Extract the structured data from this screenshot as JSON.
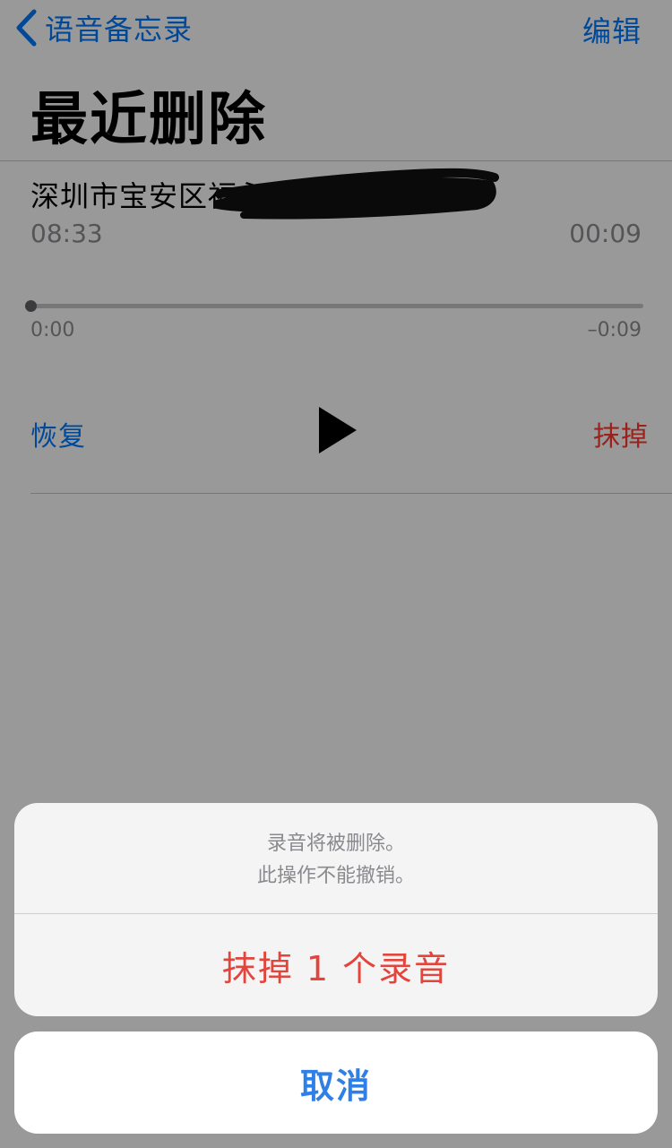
{
  "nav": {
    "back_label": "语音备忘录",
    "edit_label": "编辑"
  },
  "page": {
    "title": "最近删除"
  },
  "recording": {
    "title": "深圳市宝安区福永人民医院急诊",
    "time": "08:33",
    "duration": "00:09",
    "elapsed": "0:00",
    "remaining": "–0:09",
    "progress": 0.0
  },
  "controls": {
    "recover_label": "恢复",
    "erase_label": "抹掉",
    "play_icon": "play-icon"
  },
  "action_sheet": {
    "message_line1": "录音将被删除。",
    "message_line2": "此操作不能撤销。",
    "destructive_label": "抹掉 1 个录音",
    "cancel_label": "取消"
  },
  "colors": {
    "accent": "#007aff",
    "destructive": "#ff3b30",
    "overlay": "rgba(0,0,0,0.40)"
  }
}
